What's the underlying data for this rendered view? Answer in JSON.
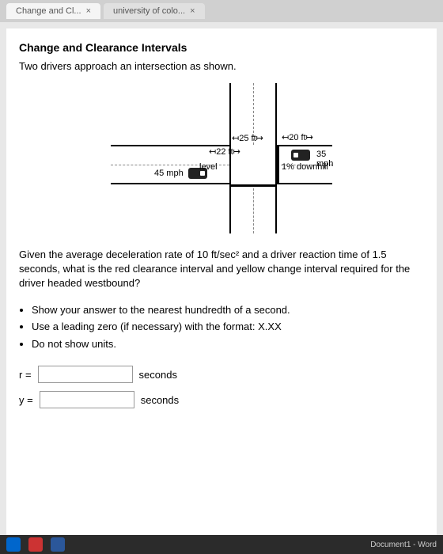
{
  "tabs": [
    {
      "label": "Change and Cl..."
    },
    {
      "label": "university of colo..."
    }
  ],
  "title": "Change and Clearance Intervals",
  "intro": "Two drivers approach an intersection as shown.",
  "diagram": {
    "dim_top_h": "20 ft",
    "speed_e": "35 mph",
    "grade_e": "1% downhill",
    "dim_w": "25 ft",
    "dim_cross": "22 ft",
    "grade_w": "level",
    "speed_w": "45 mph"
  },
  "question": "Given the average deceleration rate of 10 ft/sec² and a driver reaction time of 1.5 seconds, what is the red clearance interval and yellow change interval required for the driver headed westbound?",
  "bullets": [
    "Show your answer to the nearest hundredth of a second.",
    "Use a leading zero (if necessary) with the format: X.XX",
    "Do not show units."
  ],
  "answers": {
    "r_label": "r =",
    "r_unit": "seconds",
    "y_label": "y =",
    "y_unit": "seconds"
  },
  "taskbar": {
    "doc": "Document1 - Word"
  }
}
